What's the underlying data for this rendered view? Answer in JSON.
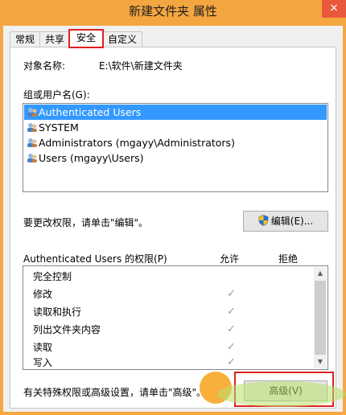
{
  "window": {
    "title": "新建文件夹 属性",
    "close_label": "×"
  },
  "tabs": [
    {
      "label": "常规",
      "active": false
    },
    {
      "label": "共享",
      "active": false
    },
    {
      "label": "安全",
      "active": true
    },
    {
      "label": "自定义",
      "active": false
    }
  ],
  "object": {
    "label": "对象名称:",
    "value": "E:\\软件\\新建文件夹"
  },
  "groups": {
    "label": "组或用户名(G):",
    "items": [
      {
        "name": "Authenticated Users",
        "selected": true
      },
      {
        "name": "SYSTEM",
        "selected": false
      },
      {
        "name": "Administrators (mgayy\\Administrators)",
        "selected": false
      },
      {
        "name": "Users (mgayy\\Users)",
        "selected": false
      }
    ]
  },
  "edit": {
    "hint": "要更改权限，请单击\"编辑\"。",
    "button_label": "编辑(E)..."
  },
  "permissions": {
    "header": "Authenticated Users 的权限(P)",
    "allow_label": "允许",
    "deny_label": "拒绝",
    "rows": [
      {
        "name": "完全控制",
        "allow": ""
      },
      {
        "name": "修改",
        "allow": "✓"
      },
      {
        "name": "读取和执行",
        "allow": "✓"
      },
      {
        "name": "列出文件夹内容",
        "allow": "✓"
      },
      {
        "name": "读取",
        "allow": "✓"
      },
      {
        "name": "写入",
        "allow": "✓"
      }
    ]
  },
  "advanced": {
    "hint": "有关特殊权限或高级设置，请单击\"高级\"。",
    "button_label": "高级(V)"
  },
  "colors": {
    "accent_highlight": "#e02020",
    "selection": "#3399ff",
    "title_bar": "#f4a640"
  }
}
